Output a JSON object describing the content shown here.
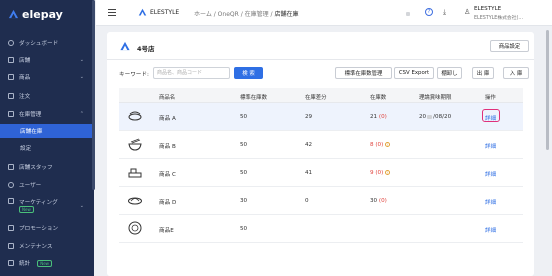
{
  "app": {
    "logo_text": "elepay"
  },
  "sidebar": {
    "items": [
      {
        "label": "ダッシュボード",
        "icon": "dashboard-icon"
      },
      {
        "label": "店舗",
        "icon": "store-icon",
        "chevron": "⌄"
      },
      {
        "label": "商品",
        "icon": "product-icon",
        "chevron": "⌄"
      },
      {
        "label": "注文",
        "icon": "order-icon"
      },
      {
        "label": "在庫管理",
        "icon": "inventory-icon",
        "chevron": "⌃"
      },
      {
        "label": "店舗在庫",
        "active": true
      },
      {
        "label": "設定"
      },
      {
        "label": "店舗スタッフ",
        "icon": "staff-icon"
      },
      {
        "label": "ユーザー",
        "icon": "user-icon"
      },
      {
        "label": "マーケティング",
        "badge": "New",
        "icon": "marketing-icon",
        "chevron": "⌄"
      },
      {
        "label": "プロモーション",
        "icon": "promotion-icon"
      },
      {
        "label": "メンテナンス",
        "icon": "maintenance-icon"
      },
      {
        "label": "統計",
        "badge": "New",
        "icon": "stats-icon"
      }
    ]
  },
  "topbar": {
    "store_name": "ELESTYLE",
    "breadcrumb": [
      "ホーム",
      "OneQR",
      "在庫管理",
      "店舗在庫"
    ],
    "user_name": "ELESTYLE",
    "user_company": "ELESTYLE株式会社(...",
    "help_label": "?"
  },
  "card": {
    "title": "4号店",
    "store_settings_label": "商品設定",
    "keyword_label": "キーワード:",
    "search_placeholder": "商品名、商品コード",
    "search_button": "検 索",
    "standard_inventory_button": "標準在庫数管理",
    "csv_export_button": "CSV Export",
    "stocktake_button": "棚卸し",
    "outbound_button": "出 庫",
    "inbound_button": "入 庫"
  },
  "table": {
    "headers": [
      "商品名",
      "標準在庫数",
      "在庫差分",
      "在庫数",
      "理論賞味期限",
      "操作"
    ],
    "rows": [
      {
        "name": "商品 A",
        "standard": "50",
        "diff": "29",
        "stock": "21",
        "stock_zero": "(0)",
        "expiry_left": "20",
        "expiry_right": "/08/20",
        "action": "詳細",
        "thumb": "meat-icon",
        "highlight": true
      },
      {
        "name": "商品 B",
        "standard": "50",
        "diff": "42",
        "stock": "8",
        "stock_zero": "(0)",
        "warn": true,
        "action": "詳細",
        "thumb": "noodle-bowl-icon"
      },
      {
        "name": "商品 C",
        "standard": "50",
        "diff": "41",
        "stock": "9",
        "stock_zero": "(0)",
        "warn": true,
        "action": "詳細",
        "thumb": "bento-icon"
      },
      {
        "name": "商品 D",
        "standard": "30",
        "diff": "0",
        "stock": "30",
        "stock_zero": "(0)",
        "action": "詳細",
        "thumb": "rice-bowl-icon"
      },
      {
        "name": "商品E",
        "standard": "50",
        "diff": "",
        "stock": "",
        "stock_zero": "",
        "action": "詳細",
        "thumb": "plate-icon"
      }
    ]
  },
  "colors": {
    "sidebar": "#1f2d4f",
    "accent": "#2f6fe4",
    "danger": "#e0403a",
    "warning": "#e2a33b"
  }
}
